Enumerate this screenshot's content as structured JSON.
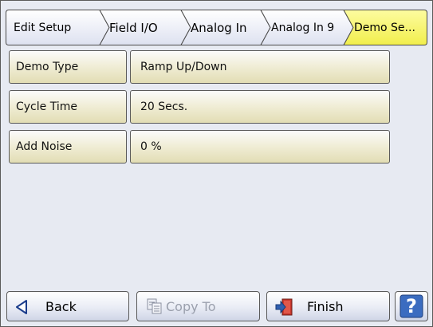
{
  "breadcrumb": {
    "items": [
      {
        "label": "Edit Setup"
      },
      {
        "label": "Field I/O"
      },
      {
        "label": "Analog In"
      },
      {
        "label": "Analog In 9"
      },
      {
        "label": "Demo Se..."
      }
    ]
  },
  "settings": {
    "rows": [
      {
        "label": "Demo Type",
        "value": "Ramp Up/Down"
      },
      {
        "label": "Cycle Time",
        "value": "20 Secs."
      },
      {
        "label": "Add Noise",
        "value": "0 %"
      }
    ]
  },
  "footer": {
    "back_label": "Back",
    "copy_label": "Copy To",
    "finish_label": "Finish",
    "help_glyph": "?"
  },
  "icons": {
    "back": "back-arrow-icon",
    "copy": "copy-icon",
    "finish": "exit-door-icon",
    "help": "help-icon"
  },
  "colors": {
    "active_crumb": "#f8f566",
    "field_fill": "#f1eed8",
    "background": "#e7eaf2",
    "help_blue": "#2f5fb0"
  }
}
